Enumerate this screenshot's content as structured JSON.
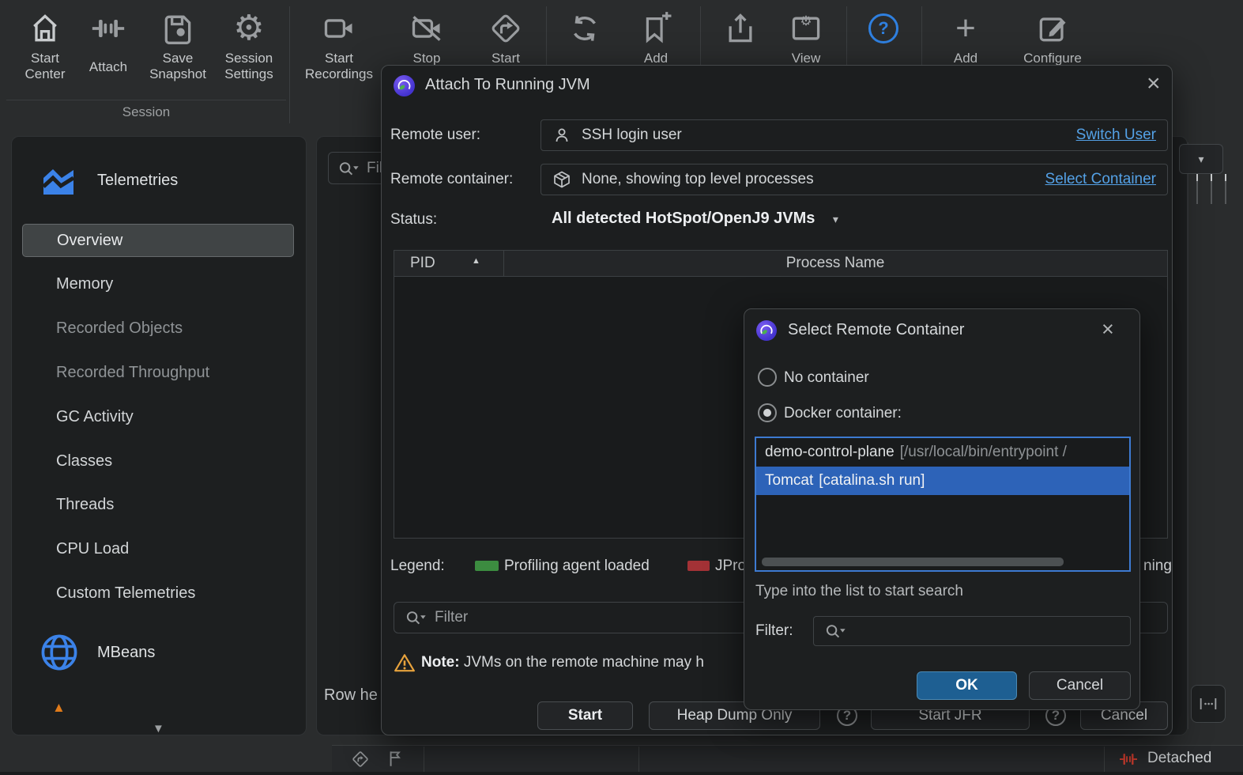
{
  "colors": {
    "background": "#2a2c2d",
    "panel": "#1d1f20",
    "dialog": "#1c1e1f",
    "accent_link": "#54a1e6",
    "selection_blue": "#2d63b8",
    "list_focus_border": "#3d7ad1",
    "ok_button_blue": "#1e5f92",
    "legend_green": "#3c8c40",
    "legend_red": "#a33236",
    "help_blue": "#2f80e0",
    "warning_orange": "#e8a33d",
    "detached_red": "#c23b2e",
    "sidebar_icon_blue": "#3b82e8"
  },
  "glyphs": {
    "close": "×",
    "caret_down": "▾",
    "sort_asc": "▲",
    "question": "?",
    "plus": "+",
    "gear": "⚙",
    "scroll_up": "▲",
    "scroll_down": "▼"
  },
  "toolbar": {
    "group_label": "Session",
    "items": [
      {
        "label": "Start Center"
      },
      {
        "label": "Attach"
      },
      {
        "label": "Save Snapshot"
      },
      {
        "label": "Session Settings"
      },
      {
        "label": "Start Recordings"
      },
      {
        "label": "Stop"
      },
      {
        "label": "Start"
      },
      {
        "label": ""
      },
      {
        "label": "Add"
      },
      {
        "label": ""
      },
      {
        "label": "View"
      },
      {
        "label": ""
      },
      {
        "label": "Add"
      },
      {
        "label": "Configure"
      }
    ]
  },
  "sidebar": {
    "telemetries": {
      "title": "Telemetries",
      "items": [
        {
          "label": "Overview",
          "selected": true
        },
        {
          "label": "Memory"
        },
        {
          "label": "Recorded Objects",
          "dimmed": true
        },
        {
          "label": "Recorded Throughput",
          "dimmed": true
        },
        {
          "label": "GC Activity"
        },
        {
          "label": "Classes"
        },
        {
          "label": "Threads"
        },
        {
          "label": "CPU Load"
        },
        {
          "label": "Custom Telemetries"
        }
      ]
    },
    "mbeans": {
      "title": "MBeans"
    }
  },
  "background": {
    "filter_fragment": "Fil",
    "row_fragment": "Row he"
  },
  "statusbar": {
    "connection": "Detached"
  },
  "attach_dialog": {
    "title": "Attach To Running JVM",
    "remote_user": {
      "label": "Remote user:",
      "value": "SSH login user",
      "action": "Switch User"
    },
    "remote_container": {
      "label": "Remote container:",
      "value": "None, showing top level processes",
      "action": "Select Container"
    },
    "status": {
      "label": "Status:",
      "value": "All detected HotSpot/OpenJ9 JVMs"
    },
    "table": {
      "col_pid": "PID",
      "col_process": "Process Name"
    },
    "legend": {
      "label": "Legend:",
      "green_label": "Profiling agent loaded",
      "red_label_fragment": "JPro",
      "trailing_fragment": "ning"
    },
    "filter_placeholder": "Filter",
    "note_prefix": "Note:",
    "note_text": " JVMs on the remote machine may h",
    "buttons": {
      "start": "Start",
      "heap_dump": "Heap Dump Only",
      "start_jfr": "Start JFR",
      "cancel": "Cancel"
    }
  },
  "container_dialog": {
    "title": "Select Remote Container",
    "option_none": "No container",
    "option_docker": "Docker container:",
    "list": [
      {
        "name": "demo-control-plane",
        "detail": "[/usr/local/bin/entrypoint /",
        "selected": false
      },
      {
        "name": "Tomcat",
        "detail": "[catalina.sh run]",
        "selected": true
      }
    ],
    "hint": "Type into the list to start search",
    "filter_label": "Filter:",
    "ok": "OK",
    "cancel": "Cancel"
  }
}
